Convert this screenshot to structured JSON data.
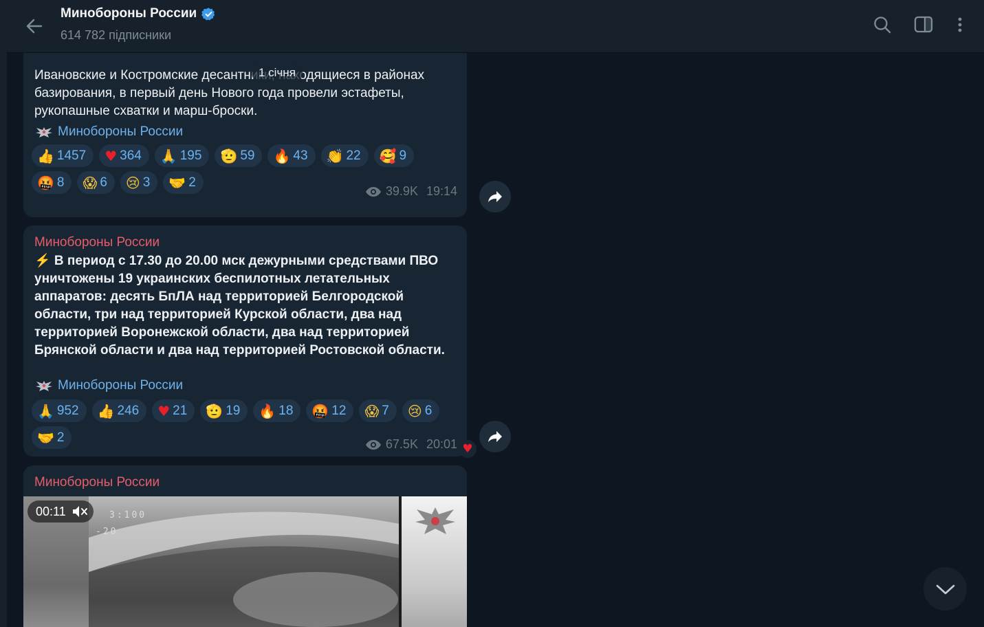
{
  "header": {
    "channel_name": "Минобороны России",
    "subscribers": "614 782 підписники"
  },
  "date_badge": "1 січня",
  "messages": [
    {
      "text": "Ивановские и Костромские десантники, находящиеся в районах базирования, в первый день Нового года провели эстафеты, рукопашные схватки и марш-броски.",
      "signature": "Минобороны России",
      "reactions_row1": [
        {
          "emoji": "👍",
          "count": "1457"
        },
        {
          "emoji": "♥",
          "count": "364"
        },
        {
          "emoji": "🙏",
          "count": "195"
        },
        {
          "emoji": "🫡",
          "count": "59"
        },
        {
          "emoji": "🔥",
          "count": "43"
        },
        {
          "emoji": "👏",
          "count": "22"
        },
        {
          "emoji": "🥰",
          "count": "9"
        }
      ],
      "reactions_row2": [
        {
          "emoji": "🤬",
          "count": "8"
        },
        {
          "emoji": "😱",
          "count": "6"
        },
        {
          "emoji": "😢",
          "count": "3"
        },
        {
          "emoji": "🤝",
          "count": "2"
        }
      ],
      "views": "39.9K",
      "time": "19:14"
    },
    {
      "sender": "Минобороны России",
      "text": "⚡ В период с 17.30 до 20.00 мск дежурными средствами ПВО уничтожены 19 украинских беспилотных летательных аппаратов: десять БпЛА над территорией Белгородской области, три над территорией Курской области, два над территорией Воронежской области, два над территорией Брянской области и два над территорией Ростовской области.",
      "signature": "Минобороны России",
      "reactions_row1": [
        {
          "emoji": "🙏",
          "count": "952"
        },
        {
          "emoji": "👍",
          "count": "246"
        },
        {
          "emoji": "♥",
          "count": "21"
        },
        {
          "emoji": "🫡",
          "count": "19"
        },
        {
          "emoji": "🔥",
          "count": "18"
        },
        {
          "emoji": "🤬",
          "count": "12"
        },
        {
          "emoji": "😱",
          "count": "7"
        },
        {
          "emoji": "😢",
          "count": "6"
        }
      ],
      "reactions_row2": [
        {
          "emoji": "🤝",
          "count": "2"
        }
      ],
      "views": "67.5K",
      "time": "20:01",
      "own_reaction": "♥"
    },
    {
      "sender": "Минобороны России",
      "video_duration": "00:11",
      "hud_top": "3:100",
      "hud_bottom": "-20"
    }
  ],
  "icons": {
    "back": "arrow-left-icon",
    "search": "search-icon",
    "sidebar": "sidebar-toggle-icon",
    "more": "kebab-menu-icon",
    "share": "share-arrow-icon",
    "scroll_down": "chevron-down-icon",
    "views": "eye-icon",
    "mute": "muted-speaker-icon"
  },
  "colors": {
    "background": "#0e1621",
    "bubble": "#182533",
    "sender_name": "#e85d6c",
    "link": "#6fb2eb",
    "verified": "#3d9be9"
  }
}
